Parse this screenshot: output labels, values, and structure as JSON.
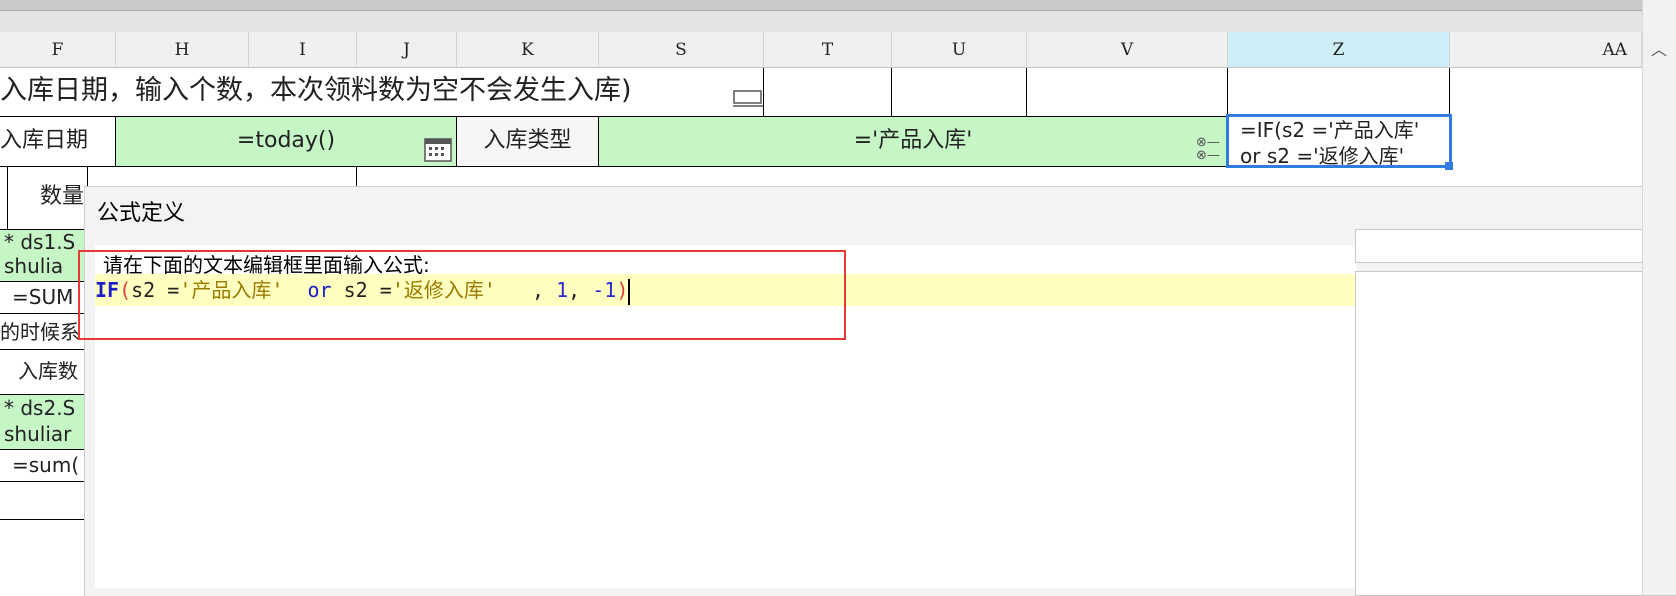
{
  "columns": [
    "F",
    "H",
    "I",
    "J",
    "K",
    "S",
    "T",
    "U",
    "V",
    "Z",
    "AA"
  ],
  "selected_column": "Z",
  "sheet": {
    "title_row": "入库日期，输入个数，本次领料数为空不会发生入库)",
    "date_label": "入库日期",
    "date_formula": "=today()",
    "type_label": "入库类型",
    "type_formula": "='产品入库'",
    "z_formula_line1": "=IF(s2 ='产品入库'",
    "z_formula_line2": "or s2 ='返修入库'",
    "left_cells": {
      "qty": "数量",
      "ds1": "* ds1.S",
      "shuliang1": "shulia",
      "sum1": "=SUM",
      "note": "的时候系",
      "in_qty": "入库数",
      "ds2": "* ds2.S",
      "shuliang2": "shuliar",
      "sum2": "=sum("
    }
  },
  "dialog": {
    "title": "公式定义",
    "instruction": "请在下面的文本编辑框里面输入公式:",
    "formula": {
      "fn": "IF",
      "open": "(",
      "part1": "s2 =",
      "str1": "'产品入库'",
      "gap1": "  ",
      "kw": "or",
      "part2": " s2 =",
      "str2": "'返修入库'",
      "part3": "   , ",
      "num1": "1",
      "part4": ", ",
      "num2": "-1",
      "close": ")"
    }
  },
  "colors": {
    "green_cell": "#c6f5c6",
    "selection": "#2f7de0",
    "highlight_box": "#e53935",
    "editor_line": "#ffffc0"
  }
}
